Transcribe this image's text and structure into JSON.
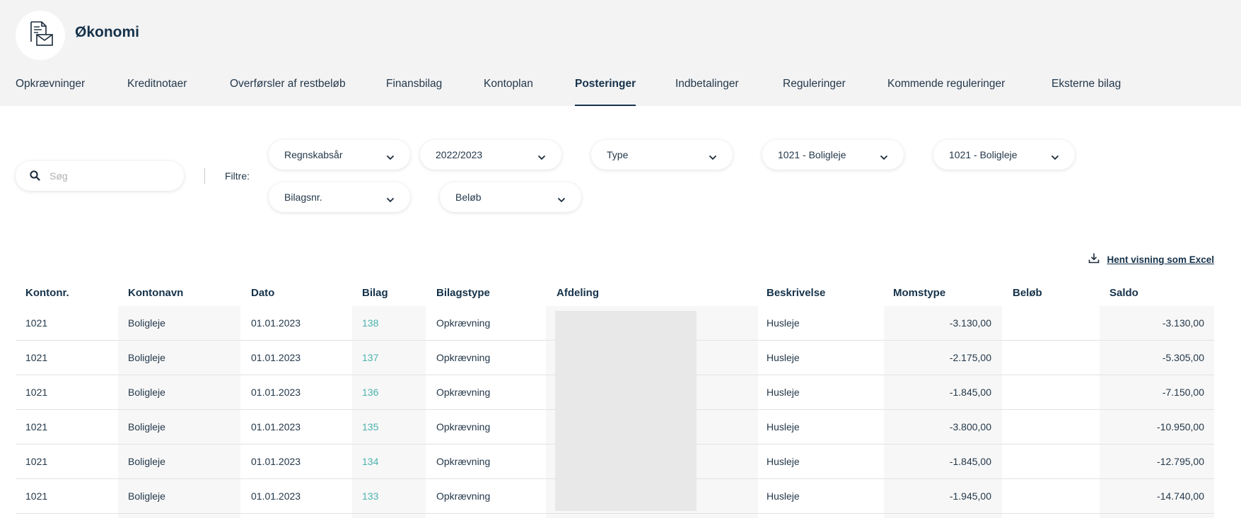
{
  "app": {
    "title": "Økonomi",
    "logo_icon": "envelope-document-icon"
  },
  "tabs": [
    {
      "label": "Opkrævninger",
      "active": false
    },
    {
      "label": "Kreditnotaer",
      "active": false
    },
    {
      "label": "Overførsler af restbeløb",
      "active": false
    },
    {
      "label": "Finansbilag",
      "active": false
    },
    {
      "label": "Kontoplan",
      "active": false
    },
    {
      "label": "Posteringer",
      "active": true
    },
    {
      "label": "Indbetalinger",
      "active": false
    },
    {
      "label": "Reguleringer",
      "active": false
    },
    {
      "label": "Kommende reguleringer",
      "active": false
    },
    {
      "label": "Eksterne bilag",
      "active": false
    }
  ],
  "search": {
    "placeholder": "Søg",
    "value": ""
  },
  "filters": {
    "label": "Filtre:",
    "dropdowns": [
      {
        "label": "Regnskabsår"
      },
      {
        "label": "2022/2023"
      },
      {
        "label": "Type"
      },
      {
        "label": "1021 - Boligleje"
      },
      {
        "label": "1021 - Boligleje"
      },
      {
        "label": "Bilagsnr."
      },
      {
        "label": "Beløb"
      }
    ]
  },
  "export": {
    "label": "Hent visning som Excel",
    "icon": "download-icon"
  },
  "table": {
    "headers": [
      "Kontonr.",
      "Kontonavn",
      "Dato",
      "Bilag",
      "Bilagstype",
      "Afdeling",
      "Beskrivelse",
      "Momstype",
      "Beløb",
      "Saldo"
    ],
    "rows": [
      {
        "kontonr": "1021",
        "kontonavn": "Boligleje",
        "dato": "01.01.2023",
        "bilag": "138",
        "bilagstype": "Opkrævning",
        "afdeling": "",
        "beskrivelse": "Husleje",
        "momstype": "",
        "belob": "-3.130,00",
        "saldo": "-3.130,00"
      },
      {
        "kontonr": "1021",
        "kontonavn": "Boligleje",
        "dato": "01.01.2023",
        "bilag": "137",
        "bilagstype": "Opkrævning",
        "afdeling": "",
        "beskrivelse": "Husleje",
        "momstype": "",
        "belob": "-2.175,00",
        "saldo": "-5.305,00"
      },
      {
        "kontonr": "1021",
        "kontonavn": "Boligleje",
        "dato": "01.01.2023",
        "bilag": "136",
        "bilagstype": "Opkrævning",
        "afdeling": "",
        "beskrivelse": "Husleje",
        "momstype": "",
        "belob": "-1.845,00",
        "saldo": "-7.150,00"
      },
      {
        "kontonr": "1021",
        "kontonavn": "Boligleje",
        "dato": "01.01.2023",
        "bilag": "135",
        "bilagstype": "Opkrævning",
        "afdeling": "",
        "beskrivelse": "Husleje",
        "momstype": "",
        "belob": "-3.800,00",
        "saldo": "-10.950,00"
      },
      {
        "kontonr": "1021",
        "kontonavn": "Boligleje",
        "dato": "01.01.2023",
        "bilag": "134",
        "bilagstype": "Opkrævning",
        "afdeling": "",
        "beskrivelse": "Husleje",
        "momstype": "",
        "belob": "-1.845,00",
        "saldo": "-12.795,00"
      },
      {
        "kontonr": "1021",
        "kontonavn": "Boligleje",
        "dato": "01.01.2023",
        "bilag": "133",
        "bilagstype": "Opkrævning",
        "afdeling": "",
        "beskrivelse": "Husleje",
        "momstype": "",
        "belob": "-1.945,00",
        "saldo": "-14.740,00"
      }
    ]
  },
  "colors": {
    "primary": "#15324a",
    "link": "#4bb3ad",
    "header_bg": "#f3f3f4",
    "column_shade": "#f7f7f7"
  }
}
